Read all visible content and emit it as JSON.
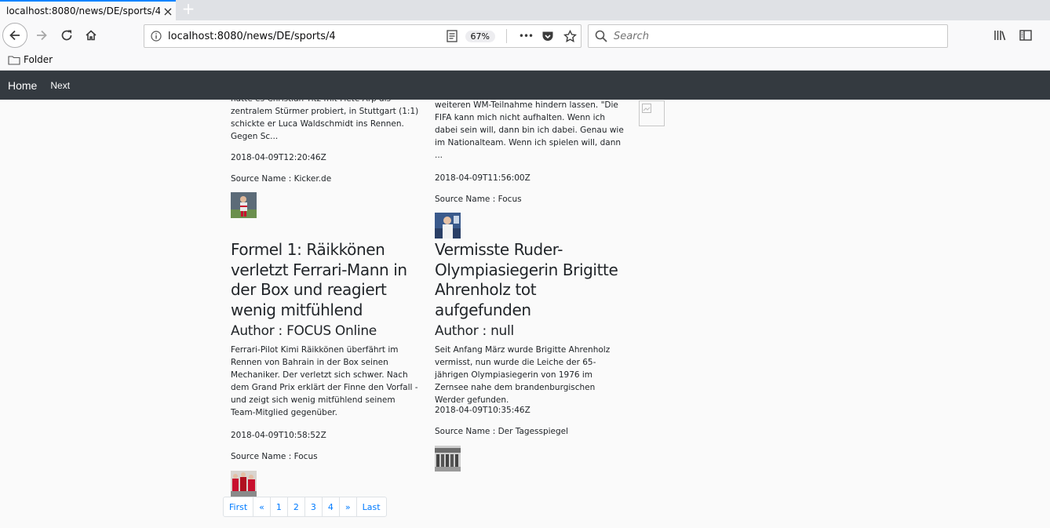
{
  "browser": {
    "tab_title": "localhost:8080/news/DE/sports/4",
    "tab_close": "×",
    "new_tab": "+",
    "url": "localhost:8080/news/DE/sports/4",
    "zoom": "67%",
    "more": "•••",
    "search_placeholder": "Search",
    "bookmark_folder": "Folder"
  },
  "site_nav": {
    "home": "Home",
    "next": "Next"
  },
  "columns": [
    {
      "top_desc": "hatte es Christian Titz mit Fiete Arp als zentralem Stürmer probiert, in Stuttgart (1:1) schickte er Luca Waldschmidt ins Rennen. Gegen Sc...",
      "top_date": "2018-04-09T12:20:46Z",
      "top_source": "Source Name : Kicker.de",
      "title": "Formel 1: Räikkönen verletzt Ferrari-Mann in der Box und reagiert wenig mitfühlend",
      "author": "Author : FOCUS Online",
      "desc": "Ferrari-Pilot Kimi Räikkönen überfährt im Rennen von Bahrain in der Box seinen Mechaniker. Der verletzt sich schwer. Nach dem Grand Prix erklärt der Finne den Vorfall - und zeigt sich wenig mitfühlend seinem Team-Mitglied gegenüber.",
      "date": "2018-04-09T10:58:52Z",
      "source": "Source Name : Focus"
    },
    {
      "top_desc": "weiteren WM-Teilnahme hindern lassen. \"Die FIFA kann mich nicht aufhalten. Wenn ich dabei sein will, dann bin ich dabei. Genau wie im Nationalteam. Wenn ich spielen will, dann ...",
      "top_date": "2018-04-09T11:56:00Z",
      "top_source": "Source Name : Focus",
      "title": "Vermisste Ruder-Olympiasiegerin Brigitte Ahrenholz tot aufgefunden",
      "author": "Author : null",
      "desc": "Seit Anfang März wurde Brigitte Ahrenholz vermisst, nun wurde die Leiche der 65-jährigen Olympiasiegerin von 1976 im Zernsee nahe dem brandenburgischen Werder gefunden.",
      "date": "2018-04-09T10:35:46Z",
      "source": "Source Name : Der Tagesspiegel"
    }
  ],
  "pagination": [
    "First",
    "«",
    "1",
    "2",
    "3",
    "4",
    "»",
    "Last"
  ],
  "colors": {
    "navbar_bg": "#343a40",
    "link": "#007bff",
    "accent": "#0a84ff"
  }
}
